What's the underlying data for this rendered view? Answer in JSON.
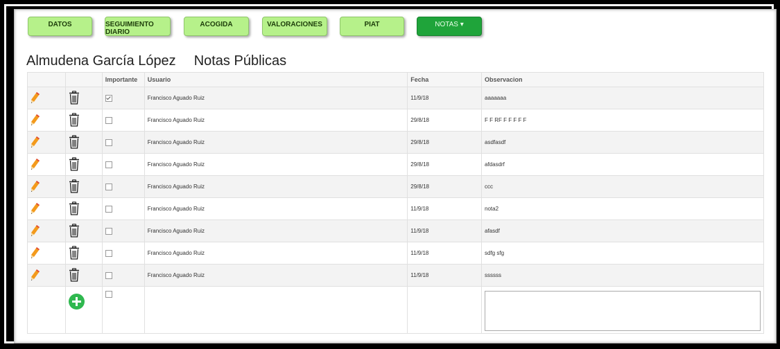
{
  "tabs": [
    {
      "label": "DATOS",
      "active": false
    },
    {
      "label": "SEGUIMIENTO DIARIO",
      "active": false
    },
    {
      "label": "ACOGIDA",
      "active": false
    },
    {
      "label": "VALORACIONES",
      "active": false
    },
    {
      "label": "PIAT",
      "active": false
    },
    {
      "label": "NOTAS ▾",
      "active": true
    }
  ],
  "header": {
    "person_name": "Almudena García López",
    "section_title": "Notas Públicas"
  },
  "table": {
    "columns": [
      "",
      "",
      "Importante",
      "Usuario",
      "Fecha",
      "Observacion"
    ],
    "rows": [
      {
        "importante": true,
        "usuario": "Francisco Aguado Ruiz",
        "fecha": "11/9/18",
        "observacion": "aaaaaaa"
      },
      {
        "importante": false,
        "usuario": "Francisco Aguado Ruiz",
        "fecha": "29/8/18",
        "observacion": "F F RF F F F F F"
      },
      {
        "importante": false,
        "usuario": "Francisco Aguado Ruiz",
        "fecha": "29/8/18",
        "observacion": "asdfasdf"
      },
      {
        "importante": false,
        "usuario": "Francisco Aguado Ruiz",
        "fecha": "29/8/18",
        "observacion": "afdasdrf"
      },
      {
        "importante": false,
        "usuario": "Francisco Aguado Ruiz",
        "fecha": "29/8/18",
        "observacion": "ccc"
      },
      {
        "importante": false,
        "usuario": "Francisco Aguado Ruiz",
        "fecha": "11/9/18",
        "observacion": "nota2"
      },
      {
        "importante": false,
        "usuario": "Francisco Aguado Ruiz",
        "fecha": "11/9/18",
        "observacion": "afasdf"
      },
      {
        "importante": false,
        "usuario": "Francisco Aguado Ruiz",
        "fecha": "11/9/18",
        "observacion": "sdfg sfg"
      },
      {
        "importante": false,
        "usuario": "Francisco Aguado Ruiz",
        "fecha": "11/9/18",
        "observacion": "ssssss"
      }
    ],
    "new_row": {
      "importante": false,
      "observacion": ""
    }
  },
  "icons": {
    "edit": "pencil-icon",
    "delete": "trash-icon",
    "add": "plus-circle-icon"
  },
  "colors": {
    "tab": "#b6f18a",
    "tab_active": "#1fa43a",
    "add_button": "#2fb84f"
  }
}
